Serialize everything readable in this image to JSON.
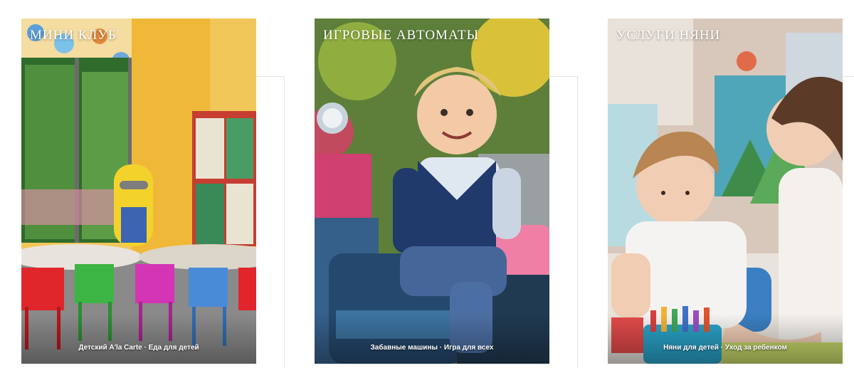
{
  "cards": [
    {
      "title": "МИНИ КЛУБ",
      "tagline": "Детский A'la Carte · Еда для детей",
      "image": "kids-playroom-photo"
    },
    {
      "title": "ИГРОВЫЕ АВТОМАТЫ",
      "tagline": "Забавные машины · Игра для всех",
      "image": "boy-on-ride-car-photo"
    },
    {
      "title": "УСЛУГИ НЯНИ",
      "tagline": "Няни для детей · Уход за ребенком",
      "image": "nanny-with-child-photo"
    }
  ],
  "colors": {
    "background": "#ffffff",
    "frame_line": "#e3e3e3",
    "text": "#ffffff"
  }
}
